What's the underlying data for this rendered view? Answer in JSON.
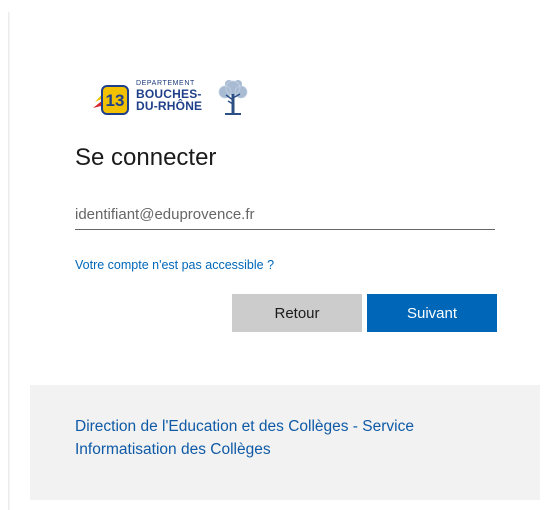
{
  "logo": {
    "department_label": "DEPARTEMENT",
    "line1": "BOUCHES-",
    "line2": "DU-RHÔNE",
    "badge_glyph": "13",
    "brand_blue": "#1f3f8a",
    "brand_yellow": "#f2c200",
    "brand_red": "#d8262f"
  },
  "signin": {
    "title": "Se connecter",
    "email_placeholder": "identifiant@eduprovence.fr",
    "email_value": "",
    "account_link": "Votre compte n'est pas accessible ?"
  },
  "buttons": {
    "back_label": "Retour",
    "next_label": "Suivant"
  },
  "footer": {
    "text": "Direction de l'Education et des Collèges - Service Informatisation des Collèges"
  },
  "colors": {
    "accent": "#0067b8",
    "secondary_button": "#cccccc",
    "footer_bg": "#f2f2f2"
  }
}
